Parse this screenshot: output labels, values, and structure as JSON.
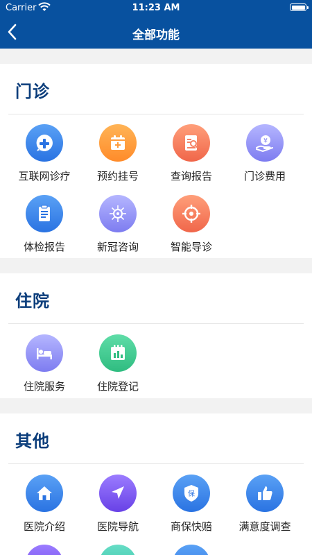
{
  "status_bar": {
    "carrier": "Carrier",
    "time": "11:23 AM"
  },
  "header": {
    "title": "全部功能"
  },
  "sections": [
    {
      "title": "门诊",
      "items": [
        {
          "label": "互联网诊疗",
          "icon": "plus-chat-icon",
          "color": "#3f86ec"
        },
        {
          "label": "预约挂号",
          "icon": "calendar-plus-icon",
          "color": "#ff9d3d"
        },
        {
          "label": "查询报告",
          "icon": "report-search-icon",
          "color": "#f58164"
        },
        {
          "label": "门诊费用",
          "icon": "yuan-hand-icon",
          "color": "#9897fb"
        },
        {
          "label": "体检报告",
          "icon": "clipboard-icon",
          "color": "#3f86ec"
        },
        {
          "label": "新冠咨询",
          "icon": "virus-icon",
          "color": "#9897fb"
        },
        {
          "label": "智能导诊",
          "icon": "target-icon",
          "color": "#f0664a"
        }
      ]
    },
    {
      "title": "住院",
      "items": [
        {
          "label": "住院服务",
          "icon": "hospital-bed-icon",
          "color": "#9897fb"
        },
        {
          "label": "住院登记",
          "icon": "calendar-chart-icon",
          "color": "#2fbc80"
        }
      ]
    },
    {
      "title": "其他",
      "items": [
        {
          "label": "医院介绍",
          "icon": "home-icon",
          "color": "#2a73e2"
        },
        {
          "label": "医院导航",
          "icon": "navigation-arrow-icon",
          "color": "#6841e6"
        },
        {
          "label": "商保快赔",
          "icon": "insurance-shield-icon",
          "color": "#2a73e2"
        },
        {
          "label": "满意度调查",
          "icon": "thumbs-up-icon",
          "color": "#2a73e2"
        }
      ]
    }
  ]
}
